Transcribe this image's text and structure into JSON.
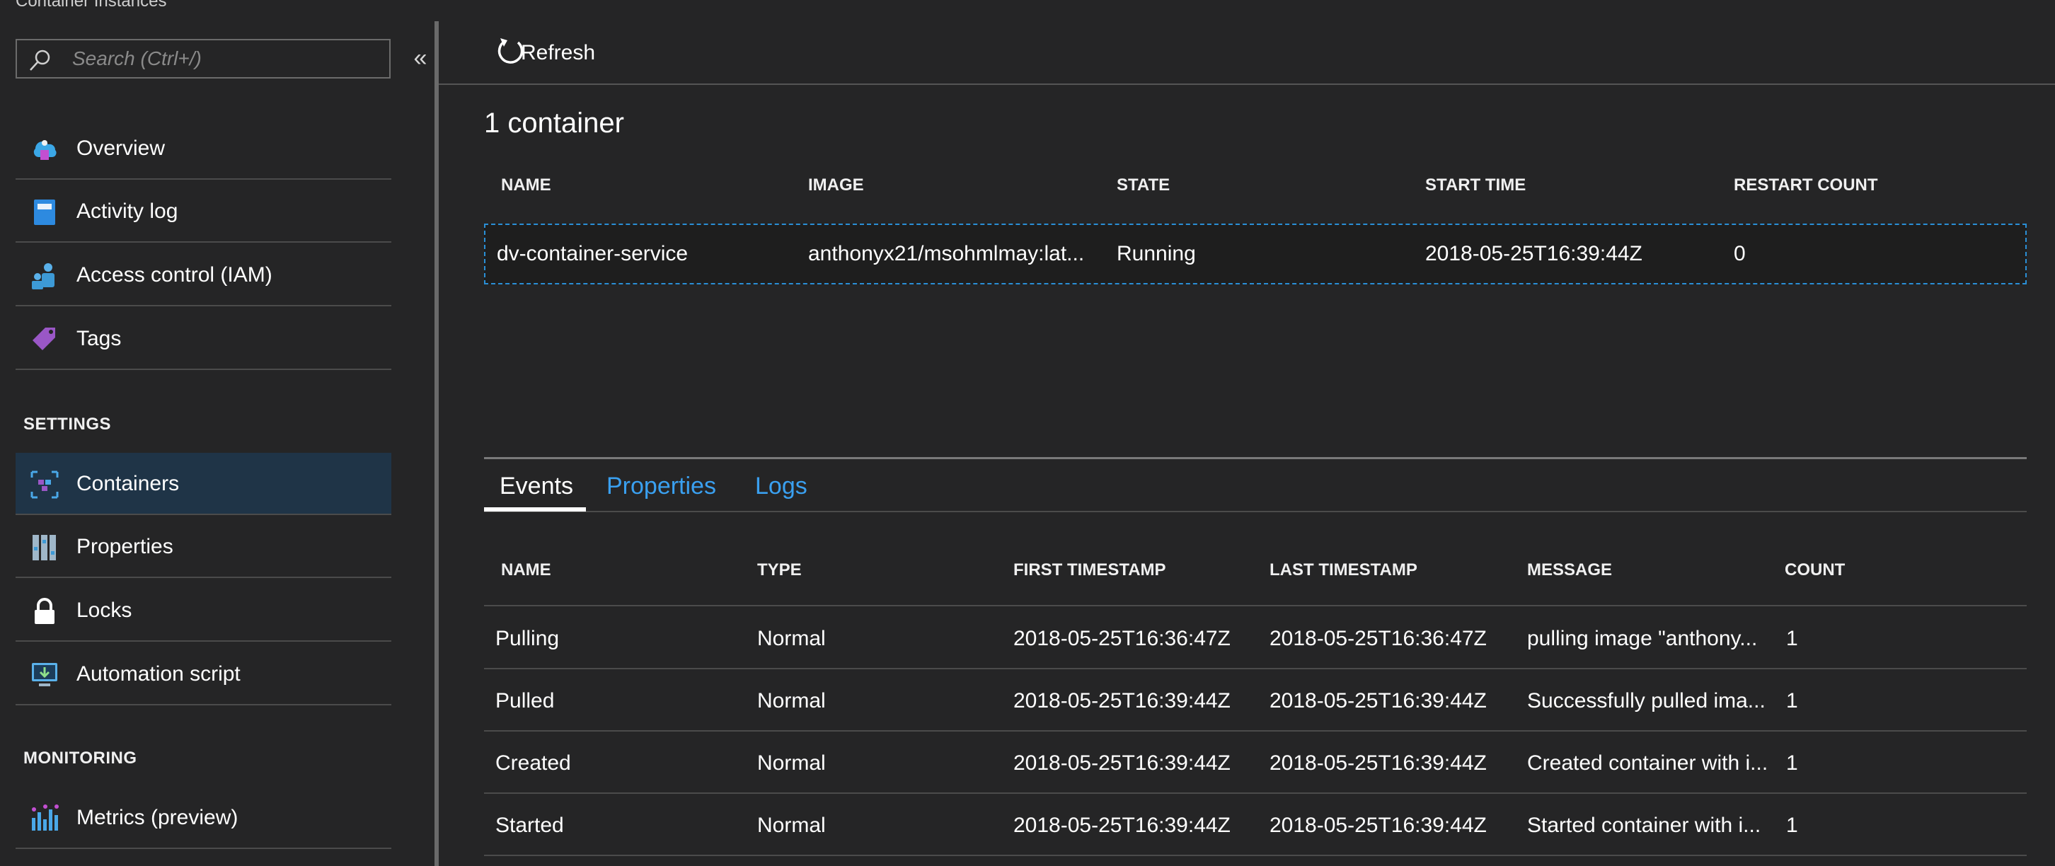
{
  "blade_title": "Container Instances",
  "search": {
    "placeholder": "Search (Ctrl+/)"
  },
  "collapse_label": "«",
  "sidebar": {
    "items": [
      {
        "label": "Overview",
        "icon": "overview-icon"
      },
      {
        "label": "Activity log",
        "icon": "activity-log-icon"
      },
      {
        "label": "Access control (IAM)",
        "icon": "iam-icon"
      },
      {
        "label": "Tags",
        "icon": "tag-icon"
      }
    ],
    "settings_header": "SETTINGS",
    "settings_items": [
      {
        "label": "Containers",
        "icon": "containers-icon",
        "active": true
      },
      {
        "label": "Properties",
        "icon": "properties-icon"
      },
      {
        "label": "Locks",
        "icon": "lock-icon"
      },
      {
        "label": "Automation script",
        "icon": "automation-script-icon"
      }
    ],
    "monitoring_header": "MONITORING",
    "monitoring_items": [
      {
        "label": "Metrics (preview)",
        "icon": "metrics-icon"
      }
    ]
  },
  "toolbar": {
    "refresh_label": "Refresh"
  },
  "container_count": "1 container",
  "containers_table": {
    "headers": [
      "NAME",
      "IMAGE",
      "STATE",
      "START TIME",
      "RESTART COUNT"
    ],
    "rows": [
      [
        "dv-container-service",
        "anthonyx21/msohmlmay:lat...",
        "Running",
        "2018-05-25T16:39:44Z",
        "0"
      ]
    ]
  },
  "tabs": [
    "Events",
    "Properties",
    "Logs"
  ],
  "active_tab": "Events",
  "events_table": {
    "headers": [
      "NAME",
      "TYPE",
      "FIRST TIMESTAMP",
      "LAST TIMESTAMP",
      "MESSAGE",
      "COUNT"
    ],
    "rows": [
      [
        "Pulling",
        "Normal",
        "2018-05-25T16:36:47Z",
        "2018-05-25T16:36:47Z",
        "pulling image \"anthony...",
        "1"
      ],
      [
        "Pulled",
        "Normal",
        "2018-05-25T16:39:44Z",
        "2018-05-25T16:39:44Z",
        "Successfully pulled ima...",
        "1"
      ],
      [
        "Created",
        "Normal",
        "2018-05-25T16:39:44Z",
        "2018-05-25T16:39:44Z",
        "Created container with i...",
        "1"
      ],
      [
        "Started",
        "Normal",
        "2018-05-25T16:39:44Z",
        "2018-05-25T16:39:44Z",
        "Started container with i...",
        "1"
      ]
    ]
  },
  "colors": {
    "background": "#252526",
    "accent": "#3aa0f0",
    "active_item": "#1f3447",
    "selection_border": "#2a8fd6"
  }
}
